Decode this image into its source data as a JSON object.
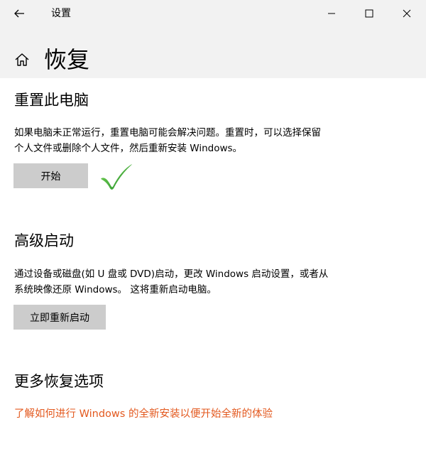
{
  "window": {
    "title": "设置"
  },
  "page": {
    "title": "恢复"
  },
  "reset_pc": {
    "title": "重置此电脑",
    "line1": "如果电脑未正常运行，重置电脑可能会解决问题。重置时，可以选择保留",
    "line2": "个人文件或删除个人文件，然后重新安装 Windows。",
    "button_label": "开始"
  },
  "advanced_startup": {
    "title": "高级启动",
    "line1": "通过设备或磁盘(如 U 盘或 DVD)启动，更改 Windows 启动设置，或者从",
    "line2": "系统映像还原 Windows。 这将重新启动电脑。",
    "button_label": "立即重新启动"
  },
  "more_options": {
    "title": "更多恢复选项",
    "link_text": "了解如何进行 Windows 的全新安装以便开始全新的体验"
  },
  "colors": {
    "accent_link": "#e3591f",
    "button_bg": "#cccccc",
    "header_bg": "#f2f2f2",
    "checkmark": "#2e9e2e"
  },
  "icons": {
    "back": "back-arrow-icon",
    "home": "home-icon",
    "minimize": "minimize-icon",
    "maximize": "maximize-icon",
    "close": "close-icon",
    "checkmark": "checkmark-icon"
  }
}
